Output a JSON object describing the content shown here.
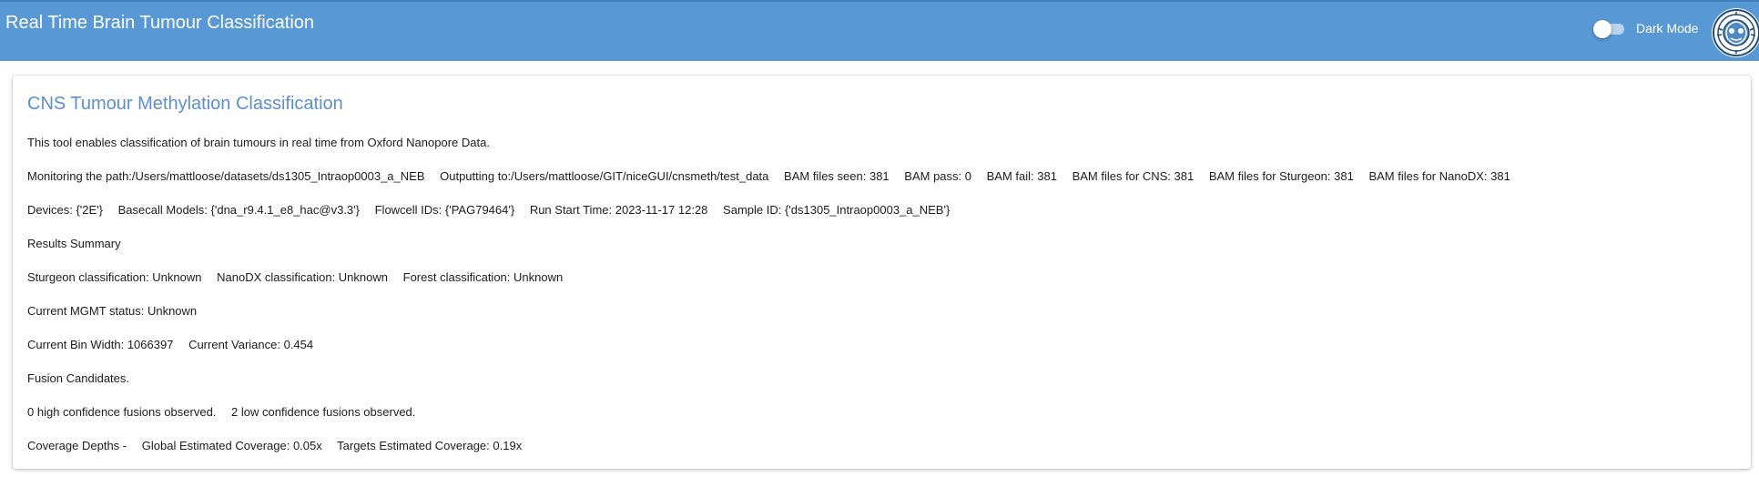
{
  "header": {
    "title": "Real Time Brain Tumour Classification",
    "dark_mode_label": "Dark Mode",
    "dark_mode_on": false
  },
  "card": {
    "title": "CNS Tumour Methylation Classification",
    "intro": "This tool enables classification of brain tumours in real time from Oxford Nanopore Data.",
    "monitoring": {
      "path": "Monitoring the path:/Users/mattloose/datasets/ds1305_Intraop0003_a_NEB",
      "output": "Outputting to:/Users/mattloose/GIT/niceGUI/cnsmeth/test_data",
      "bam_seen": "BAM files seen: 381",
      "bam_pass": "BAM pass: 0",
      "bam_fail": "BAM fail: 381",
      "bam_cns": "BAM files for CNS: 381",
      "bam_sturgeon": "BAM files for Sturgeon: 381",
      "bam_nanodx": "BAM files for NanoDX: 381"
    },
    "run_info": {
      "devices": "Devices: {'2E'}",
      "basecall_models": "Basecall Models: {'dna_r9.4.1_e8_hac@v3.3'}",
      "flowcell_ids": "Flowcell IDs: {'PAG79464'}",
      "run_start": "Run Start Time: 2023-11-17 12:28",
      "sample_id": "Sample ID: {'ds1305_Intraop0003_a_NEB'}"
    },
    "results_summary": "Results Summary",
    "classifications": {
      "sturgeon": "Sturgeon classification: Unknown",
      "nanodx": "NanoDX classification: Unknown",
      "forest": "Forest classification: Unknown"
    },
    "mgmt_status": "Current MGMT status: Unknown",
    "cnv": {
      "bin_width": "Current Bin Width: 1066397",
      "variance": "Current Variance: 0.454"
    },
    "fusion_heading": "Fusion Candidates.",
    "fusions": {
      "high": "0 high confidence fusions observed.",
      "low": "2 low confidence fusions observed."
    },
    "coverage": {
      "label": "Coverage Depths -",
      "global": "Global Estimated Coverage: 0.05x",
      "targets": "Targets Estimated Coverage: 0.19x"
    }
  },
  "colors": {
    "header_bg": "#5898d4",
    "card_title": "#5c8fd0"
  },
  "icons": {
    "logo": "lab-logo-icon"
  }
}
